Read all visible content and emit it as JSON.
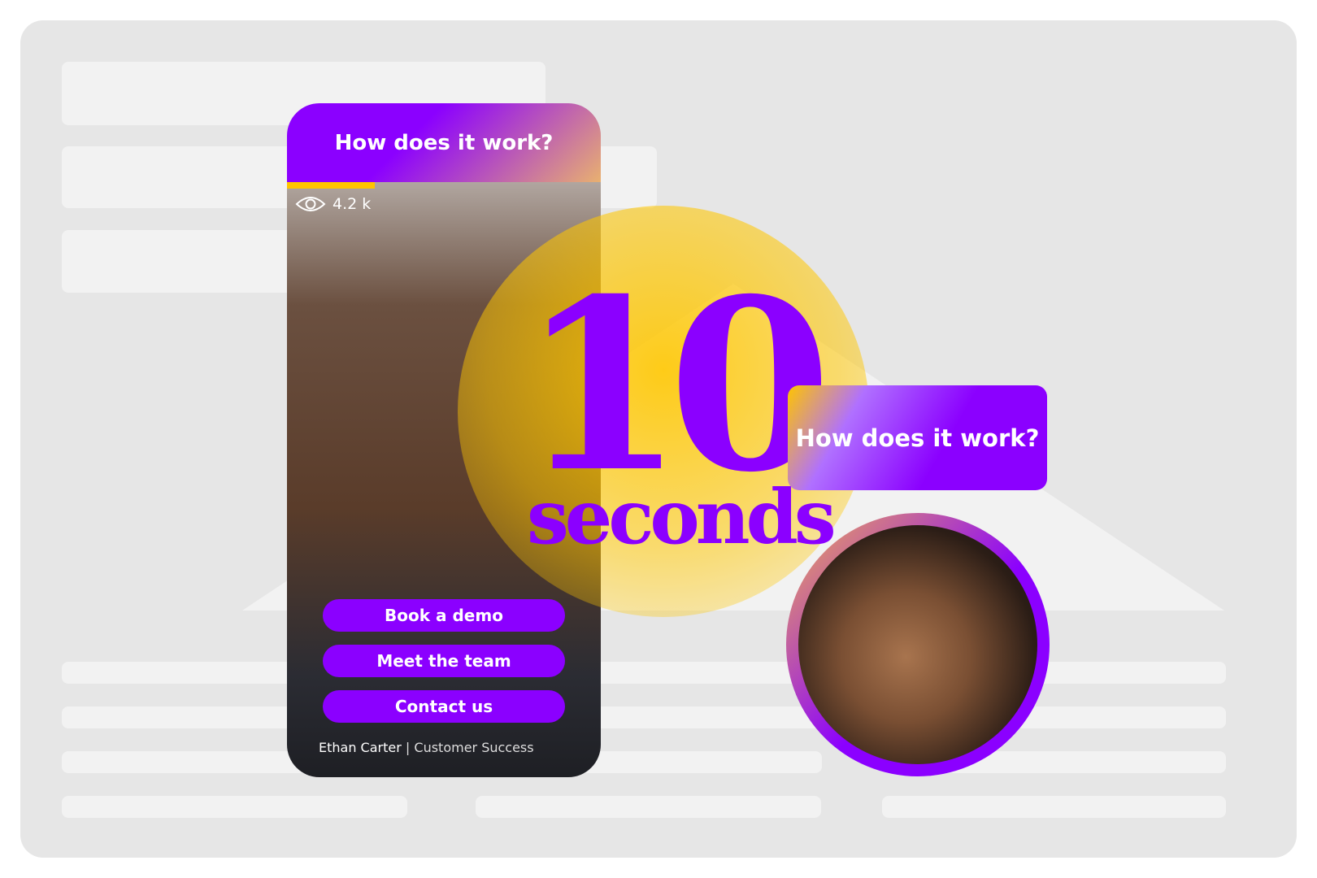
{
  "phone": {
    "title": "How does it work?",
    "views": "4.2 k",
    "progress_percent": 28,
    "buttons": [
      "Book a demo",
      "Meet the team",
      "Contact us"
    ],
    "presenter_name": "Ethan Carter",
    "separator": "|",
    "presenter_role": "Customer Success"
  },
  "headline": {
    "number": "10",
    "unit": "seconds"
  },
  "side_button": {
    "label": "How does it work?"
  },
  "colors": {
    "accent": "#8b00ff",
    "gold": "#ffc400",
    "background": "#e6e6e6",
    "placeholder": "#f2f2f2"
  }
}
